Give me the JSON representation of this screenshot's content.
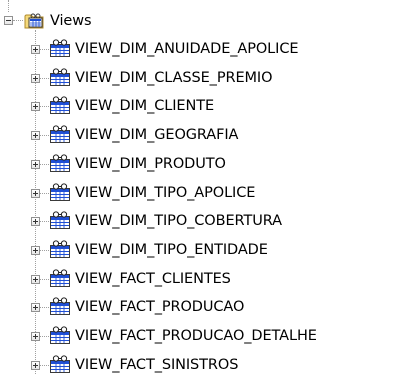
{
  "tree": {
    "root": {
      "label": "Views",
      "expanded": true
    },
    "items": [
      {
        "label": "VIEW_DIM_ANUIDADE_APOLICE"
      },
      {
        "label": "VIEW_DIM_CLASSE_PREMIO"
      },
      {
        "label": "VIEW_DIM_CLIENTE"
      },
      {
        "label": "VIEW_DIM_GEOGRAFIA"
      },
      {
        "label": "VIEW_DIM_PRODUTO"
      },
      {
        "label": "VIEW_DIM_TIPO_APOLICE"
      },
      {
        "label": "VIEW_DIM_TIPO_COBERTURA"
      },
      {
        "label": "VIEW_DIM_TIPO_ENTIDADE"
      },
      {
        "label": "VIEW_FACT_CLIENTES"
      },
      {
        "label": "VIEW_FACT_PRODUCAO"
      },
      {
        "label": "VIEW_FACT_PRODUCAO_DETALHE"
      },
      {
        "label": "VIEW_FACT_SINISTROS"
      }
    ],
    "colors": {
      "folder_fill": "#f5d97a",
      "folder_stroke": "#b08a2a",
      "view_blue": "#1f4fd6",
      "view_frame": "#3a3a3a",
      "line": "#a0a0a0"
    }
  }
}
